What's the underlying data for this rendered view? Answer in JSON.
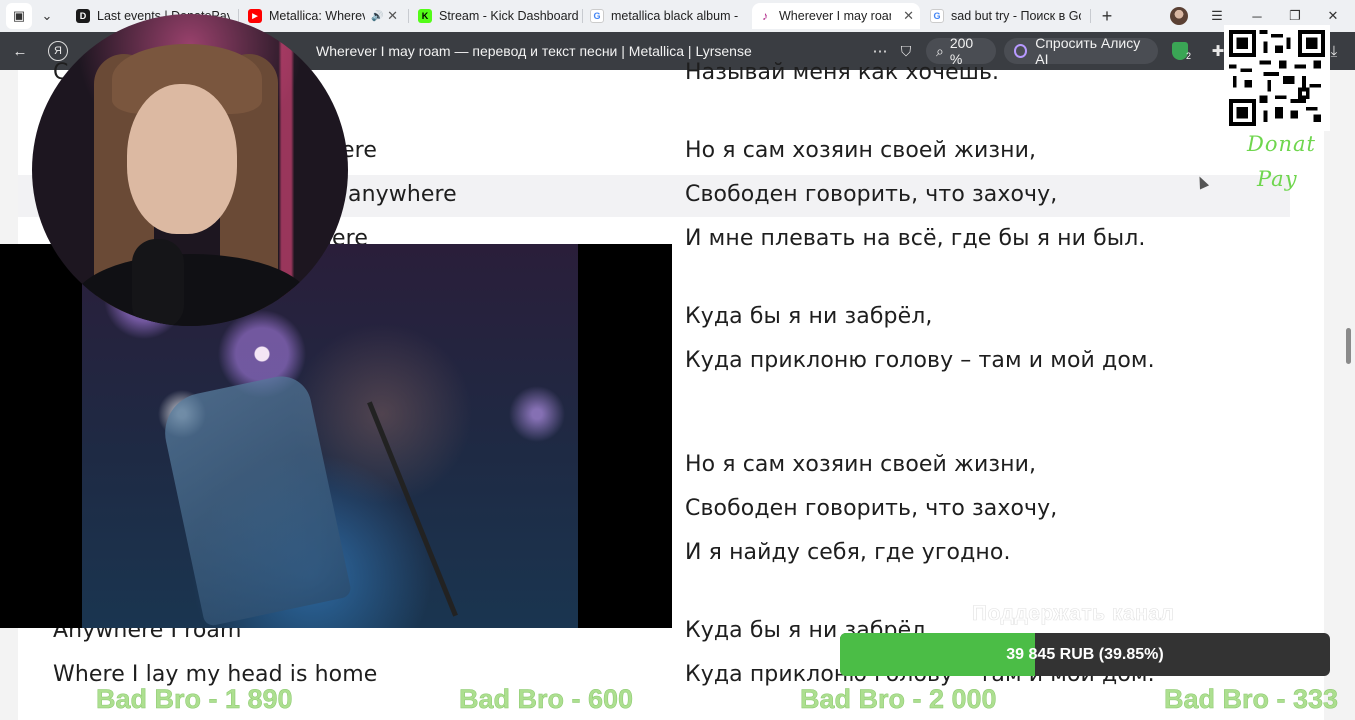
{
  "tabs": [
    {
      "label": "Last events | DonatePay",
      "favicon": "D",
      "color": "#1a1a1a"
    },
    {
      "label": "Metallica: Wherever",
      "favicon": "▶",
      "color": "#ff0000",
      "audio": "🔊"
    },
    {
      "label": "Stream - Kick Dashboard",
      "favicon": "K",
      "color": "#53fc18"
    },
    {
      "label": "metallica black album - Поиск",
      "favicon": "G",
      "color": "#4285f4"
    },
    {
      "label": "Wherever I may roam —",
      "favicon": "♪",
      "color": "#b0288a"
    },
    {
      "label": "sad but try - Поиск в Google",
      "favicon": "G",
      "color": "#4285f4"
    }
  ],
  "browser": {
    "page_title": "Wherever I may roam — перевод и текст песни | Metallica | Lyrsense",
    "zoom": "200 %",
    "alice_label": "Спросить Алису AI",
    "ext_badge": "2"
  },
  "lyrics": {
    "left": [
      "С",
      "here",
      "anywhere",
      "here",
      "Anywhere I roam",
      "Where I lay my head is home"
    ],
    "right": [
      "Называй меня как хочешь.",
      "Но я сам хозяин своей жизни,",
      "Свободен говорить, что захочу,",
      "И мне плевать на всё, где бы я ни был.",
      "Куда бы я ни забрёл,",
      "Куда приклоню голову – там и мой дом.",
      "Но я сам хозяин своей жизни,",
      "Свободен говорить, что захочу,",
      "И я найду себя, где угодно.",
      "Куда бы я ни забрёл,",
      "Куда приклоню голову – там и мой дом."
    ]
  },
  "overlay": {
    "donat": [
      "Donat",
      "Pay"
    ],
    "support_label": "Поддержать канал",
    "goal_text": "39 845 RUB (39.85%)",
    "goal_fraction": 0.3985,
    "donors": [
      "Bad Bro - 1 890",
      "Bad Bro - 600",
      "Bad Bro - 2 000",
      "Bad Bro - 333"
    ]
  }
}
